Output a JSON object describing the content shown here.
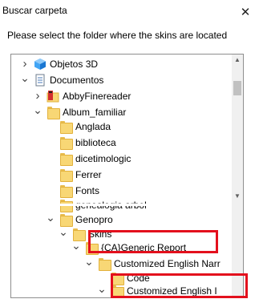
{
  "dialog": {
    "title": "Buscar carpeta",
    "close_glyph": "✕",
    "instruction": "Please select the folder where the skins are located"
  },
  "tree": {
    "items": [
      {
        "label": "Objetos 3D",
        "icon": "objects-3d-icon",
        "expander": "collapsed"
      },
      {
        "label": "Documentos",
        "icon": "documents-icon",
        "expander": "expanded"
      },
      {
        "label": "AbbyFinereader",
        "icon": "abbyy-folder-icon",
        "expander": "collapsed"
      },
      {
        "label": "Album_familiar",
        "icon": "folder-icon",
        "expander": "expanded"
      },
      {
        "label": "Anglada",
        "icon": "folder-icon",
        "expander": "none"
      },
      {
        "label": "biblioteca",
        "icon": "folder-icon",
        "expander": "none"
      },
      {
        "label": "dicetimologic",
        "icon": "folder-icon",
        "expander": "none"
      },
      {
        "label": "Ferrer",
        "icon": "folder-icon",
        "expander": "none"
      },
      {
        "label": "Fonts",
        "icon": "folder-icon",
        "expander": "none"
      },
      {
        "label": "genealogia arbol",
        "icon": "folder-icon",
        "expander": "none"
      },
      {
        "label": "Genopro",
        "icon": "folder-icon",
        "expander": "expanded"
      },
      {
        "label": "Skins",
        "icon": "folder-icon",
        "expander": "expanded"
      },
      {
        "label": "{CA}Generic Report",
        "icon": "folder-icon",
        "expander": "expanded"
      },
      {
        "label": "Customized English Narr",
        "icon": "folder-icon",
        "expander": "expanded"
      },
      {
        "label": "Code",
        "icon": "folder-icon",
        "expander": "none"
      },
      {
        "label": "Customized English I",
        "icon": "folder-icon",
        "expander": "expanded"
      }
    ]
  },
  "scrollbar": {
    "up_glyph": "▲",
    "down_glyph": "▼"
  },
  "colors": {
    "highlight": "#e3101d",
    "folder": "#f8d775",
    "border": "#8e8e8e"
  }
}
